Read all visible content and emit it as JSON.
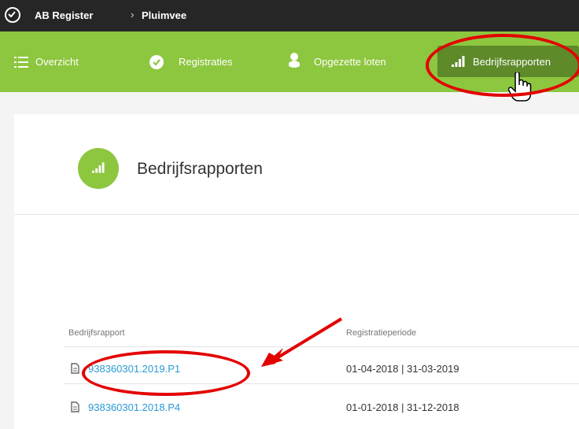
{
  "topbar": {
    "app_name": "AB Register",
    "separator": "›",
    "section": "Pluimvee"
  },
  "nav": {
    "items": [
      {
        "label": "Overzicht",
        "icon": "list-icon"
      },
      {
        "label": "Registraties",
        "icon": "check-circle-icon"
      },
      {
        "label": "Opgezette loten",
        "icon": "chick-icon"
      },
      {
        "label": "Bedrijfsrapporten",
        "icon": "signal-bars-icon",
        "active": true
      }
    ]
  },
  "page": {
    "title": "Bedrijfsrapporten",
    "icon": "signal-bars-icon"
  },
  "table": {
    "columns": [
      "Bedrijfsrapport",
      "Registratieperiode"
    ],
    "rows": [
      {
        "report": "938360301.2019.P1",
        "period": "01-04-2018 | 31-03-2019"
      },
      {
        "report": "938360301.2018.P4",
        "period": "01-01-2018 | 31-12-2018"
      }
    ]
  },
  "colors": {
    "nav_green": "#8dc63f",
    "nav_active": "#5e8a2a",
    "topbar": "#262626",
    "link_blue": "#2a9ad6",
    "annotation_red": "#e30000"
  }
}
